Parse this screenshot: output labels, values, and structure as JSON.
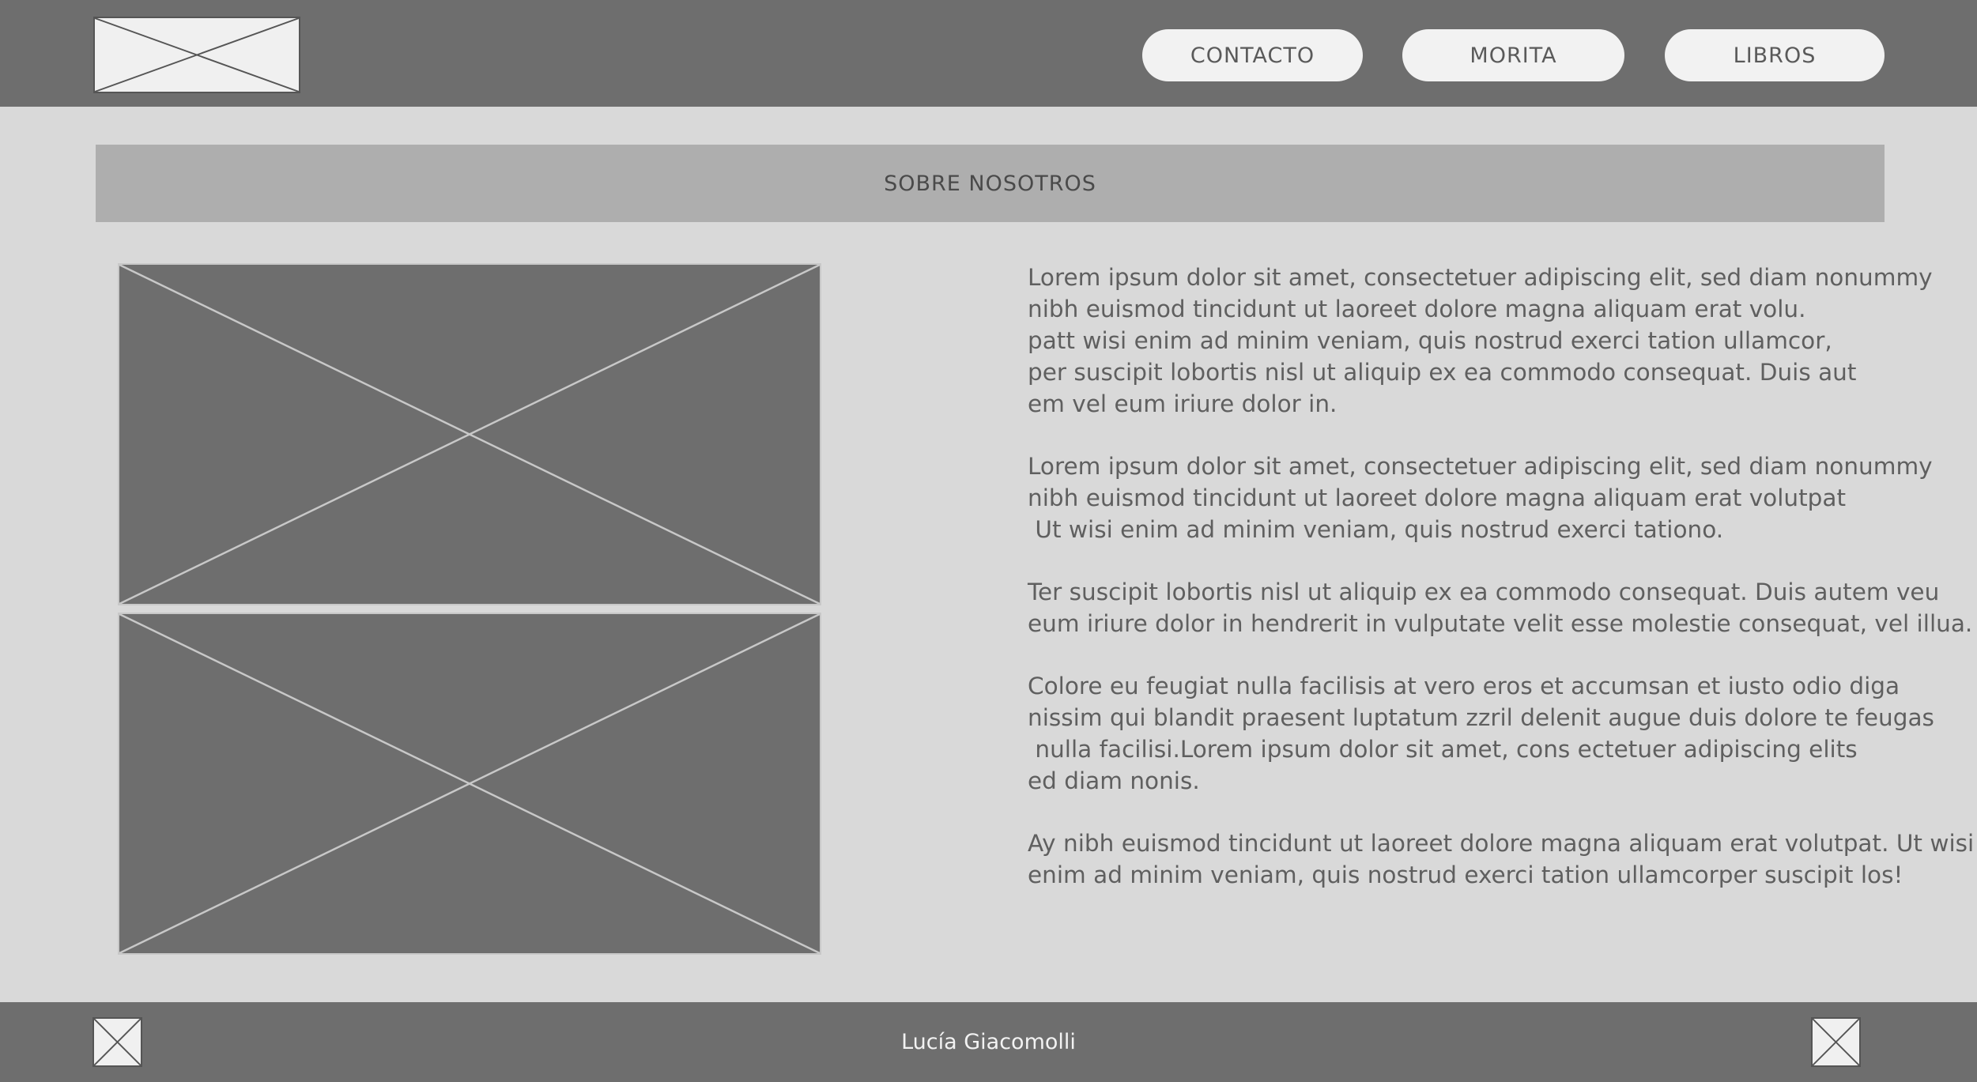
{
  "header": {
    "logo_icon": "image-placeholder-icon",
    "nav": [
      {
        "label": "CONTACTO"
      },
      {
        "label": "MORITA"
      },
      {
        "label": "LIBROS"
      }
    ]
  },
  "section": {
    "title": "SOBRE NOSOTROS"
  },
  "images": [
    {
      "icon": "image-placeholder-icon"
    },
    {
      "icon": "image-placeholder-icon"
    }
  ],
  "paragraphs": [
    {
      "lines": [
        "Lorem ipsum dolor sit amet, consectetuer adipiscing elit, sed diam nonummy",
        "nibh euismod tincidunt ut laoreet dolore magna aliquam erat volu.",
        "patt wisi enim ad minim veniam, quis nostrud exerci tation ullamcor,",
        "per suscipit lobortis nisl ut aliquip ex ea commodo consequat. Duis aut",
        "em vel eum iriure dolor in."
      ]
    },
    {
      "lines": [
        "Lorem ipsum dolor sit amet, consectetuer adipiscing elit, sed diam nonummy",
        "nibh euismod tincidunt ut laoreet dolore magna aliquam erat volutpat",
        " Ut wisi enim ad minim veniam, quis nostrud exerci tationo."
      ]
    },
    {
      "lines": [
        "Ter suscipit lobortis nisl ut aliquip ex ea commodo consequat. Duis autem veu",
        "eum iriure dolor in hendrerit in vulputate velit esse molestie consequat, vel illua."
      ]
    },
    {
      "lines": [
        "Colore eu feugiat nulla facilisis at vero eros et accumsan et iusto odio diga",
        "nissim qui blandit praesent luptatum zzril delenit augue duis dolore te feugas",
        " nulla facilisi.Lorem ipsum dolor sit amet, cons ectetuer adipiscing elits",
        "ed diam nonis."
      ]
    },
    {
      "lines": [
        "Ay nibh euismod tincidunt ut laoreet dolore magna aliquam erat volutpat. Ut wisi",
        "enim ad minim veniam, quis nostrud exerci tation ullamcorper suscipit los!"
      ]
    }
  ],
  "footer": {
    "name": "Lucía Giacomolli",
    "left_icon": "image-placeholder-icon",
    "right_icon": "image-placeholder-icon"
  },
  "colors": {
    "header_bg": "#6e6e6e",
    "page_bg": "#d9d9d9",
    "title_band_bg": "#aeaeae",
    "button_bg": "#f2f2f2"
  }
}
